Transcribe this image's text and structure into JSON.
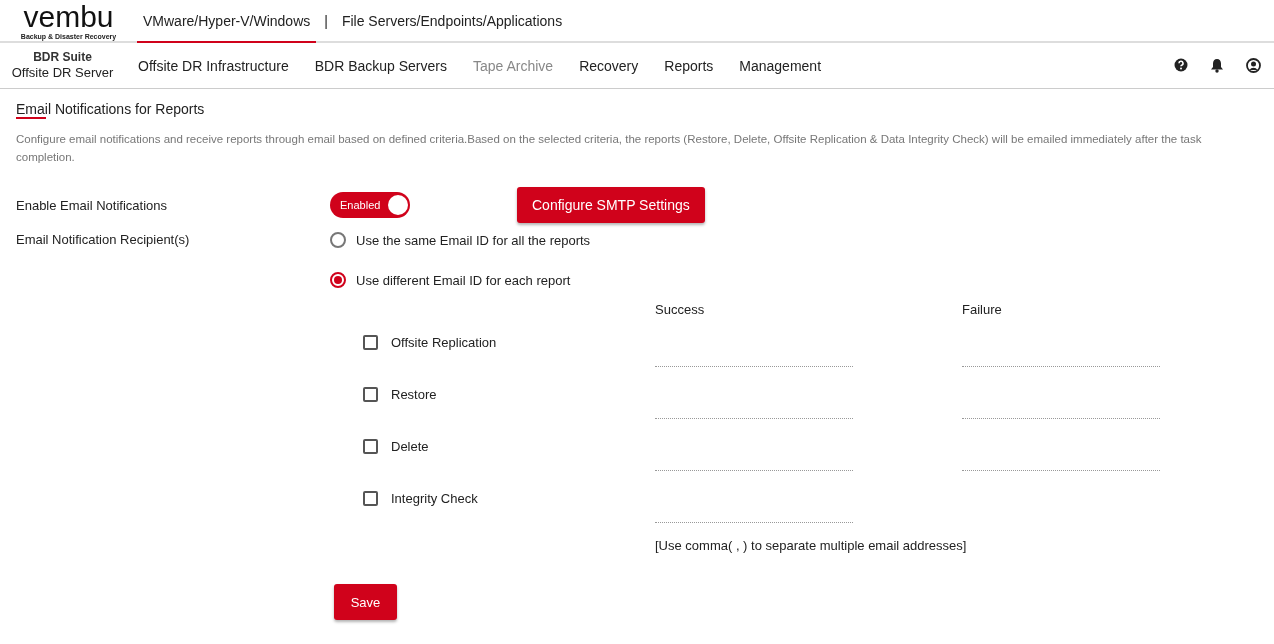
{
  "logo": {
    "name": "vembu",
    "tagline": "Backup & Disaster Recovery"
  },
  "top_tabs": [
    {
      "label": "VMware/Hyper-V/Windows",
      "selected": true
    },
    {
      "label": "File Servers/Endpoints/Applications",
      "selected": false
    }
  ],
  "top_separator": "|",
  "product": {
    "suite": "BDR Suite",
    "name": "Offsite DR Server"
  },
  "nav": [
    {
      "label": "Offsite DR Infrastructure",
      "disabled": false
    },
    {
      "label": "BDR Backup Servers",
      "disabled": false
    },
    {
      "label": "Tape Archive",
      "disabled": true
    },
    {
      "label": "Recovery",
      "disabled": false
    },
    {
      "label": "Reports",
      "disabled": false
    },
    {
      "label": "Management",
      "disabled": false
    }
  ],
  "page": {
    "title": "Email Notifications for Reports",
    "description": "Configure email notifications and receive reports through email based on defined criteria.Based on the selected criteria, the reports (Restore, Delete, Offsite Replication & Data Integrity Check) will be emailed immediately after the task completion."
  },
  "enable": {
    "label": "Enable Email Notifications",
    "toggle_label": "Enabled",
    "on": true,
    "smtp_button": "Configure SMTP Settings"
  },
  "recipients": {
    "label": "Email Notification Recipient(s)",
    "options": [
      {
        "label": "Use the same Email ID for all the reports",
        "selected": false
      },
      {
        "label": "Use different Email ID for each report",
        "selected": true
      }
    ]
  },
  "columns": [
    "Success",
    "Failure"
  ],
  "reports": [
    {
      "label": "Offsite Replication",
      "checked": false,
      "failure_field": true
    },
    {
      "label": "Restore",
      "checked": false,
      "failure_field": true
    },
    {
      "label": "Delete",
      "checked": false,
      "failure_field": true
    },
    {
      "label": "Integrity Check",
      "checked": false,
      "failure_field": false
    }
  ],
  "hint": "[Use comma( , ) to separate multiple email addresses]",
  "save_button": "Save"
}
